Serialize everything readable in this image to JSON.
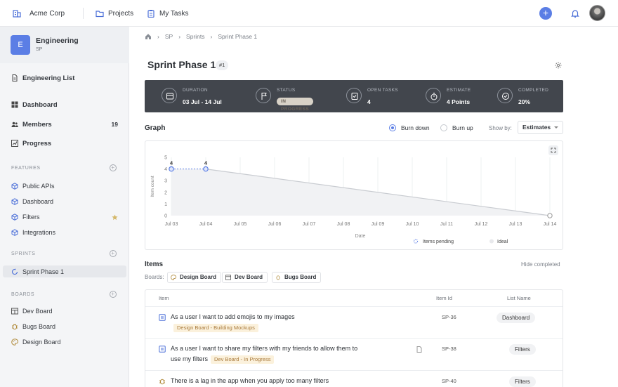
{
  "topbar": {
    "org": "Acme Corp",
    "projects": "Projects",
    "my_tasks": "My Tasks",
    "add": "+"
  },
  "sidebar": {
    "project": {
      "letter": "E",
      "name": "Engineering",
      "key": "SP"
    },
    "list": "Engineering List",
    "nav": [
      {
        "label": "Dashboard",
        "icon": "grid-icon"
      },
      {
        "label": "Members",
        "icon": "users-icon",
        "count": "19"
      },
      {
        "label": "Progress",
        "icon": "chart-icon"
      }
    ],
    "features_heading": "FEATURES",
    "features": [
      "Public APIs",
      "Dashboard",
      "Filters",
      "Integrations"
    ],
    "sprints_heading": "SPRINTS",
    "sprints": [
      "Sprint Phase 1"
    ],
    "boards_heading": "BOARDS",
    "boards": [
      "Dev Board",
      "Bugs Board",
      "Design Board"
    ]
  },
  "breadcrumb": [
    "SP",
    "Sprints",
    "Sprint Phase 1"
  ],
  "page": {
    "title": "Sprint Phase 1",
    "number": "#1"
  },
  "stats": [
    {
      "label": "DURATION",
      "value": "03 Jul - 14 Jul",
      "icon": "calendar-icon"
    },
    {
      "label": "STATUS",
      "value": "IN PROGRESS",
      "icon": "flag-icon"
    },
    {
      "label": "OPEN TASKS",
      "value": "4",
      "icon": "checklist-icon"
    },
    {
      "label": "ESTIMATE",
      "value": "4 Points",
      "icon": "stopwatch-icon"
    },
    {
      "label": "COMPLETED",
      "value": "20%",
      "icon": "check-circle-icon"
    }
  ],
  "graph": {
    "heading": "Graph",
    "burn_down": "Burn down",
    "burn_up": "Burn up",
    "show_by_label": "Show by:",
    "show_by_value": "Estimates"
  },
  "chart_data": {
    "type": "line",
    "x": [
      "Jul 03",
      "Jul 04",
      "Jul 05",
      "Jul 06",
      "Jul 07",
      "Jul 08",
      "Jul 09",
      "Jul 10",
      "Jul 11",
      "Jul 12",
      "Jul 13",
      "Jul 14"
    ],
    "series": [
      {
        "name": "Items pending",
        "values": [
          4,
          4
        ]
      },
      {
        "name": "Ideal",
        "values": [
          4,
          0
        ]
      }
    ],
    "ideal_x": [
      "Jul 04",
      "Jul 14"
    ],
    "point_labels": [
      "4",
      "4"
    ],
    "ylabel": "Item count",
    "xlabel": "Date",
    "yticks": [
      "0",
      "1",
      "2",
      "3",
      "4",
      "5"
    ],
    "ylim": [
      0,
      5
    ],
    "colors": {
      "pending": "#5b7ee5",
      "ideal": "#c9ccd1"
    }
  },
  "items": {
    "heading": "Items",
    "hide_completed": "Hide completed",
    "boards_label": "Boards:",
    "boards": [
      "Design Board",
      "Dev Board",
      "Bugs Board"
    ],
    "columns": [
      "Item",
      "Item Id",
      "List Name"
    ],
    "rows": [
      {
        "title": "As a user I want to add emojis to my images",
        "board": "Design Board - Building Mockups",
        "id": "SP-36",
        "list": "Dashboard"
      },
      {
        "title": "As a user I want to share my filters with my friends to allow them to",
        "title2": "use my filters",
        "board": "Dev Board - In Progress",
        "id": "SP-38",
        "list": "Filters"
      },
      {
        "title": "There is a lag in the app when you apply too many filters",
        "id": "SP-40",
        "list": "Filters"
      }
    ]
  }
}
